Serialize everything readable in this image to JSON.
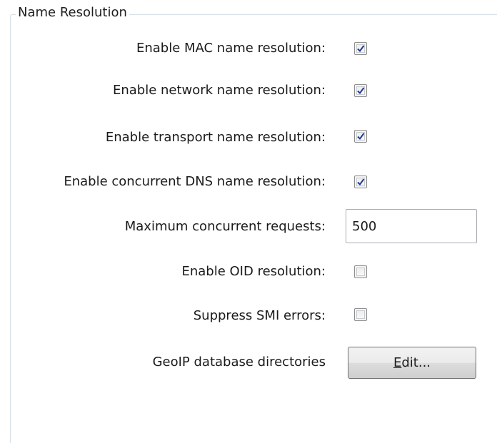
{
  "group": {
    "title": "Name Resolution"
  },
  "options": [
    {
      "key": "mac",
      "label": "Enable MAC name resolution:",
      "checked": true
    },
    {
      "key": "network",
      "label": "Enable network name resolution:",
      "checked": true
    },
    {
      "key": "transport",
      "label": "Enable transport name resolution:",
      "checked": true
    },
    {
      "key": "dns",
      "label": "Enable concurrent DNS name resolution:",
      "checked": true
    },
    {
      "key": "oid",
      "label": "Enable OID resolution:",
      "checked": false
    },
    {
      "key": "smi",
      "label": "Suppress SMI errors:",
      "checked": false
    }
  ],
  "max_requests": {
    "label": "Maximum concurrent requests:",
    "value": "500"
  },
  "geoip": {
    "label": "GeoIP database directories",
    "button_mnemonic": "E",
    "button_rest": "dit..."
  },
  "colors": {
    "check_mark": "#1f3a93",
    "frame": "#d5dfe5"
  }
}
